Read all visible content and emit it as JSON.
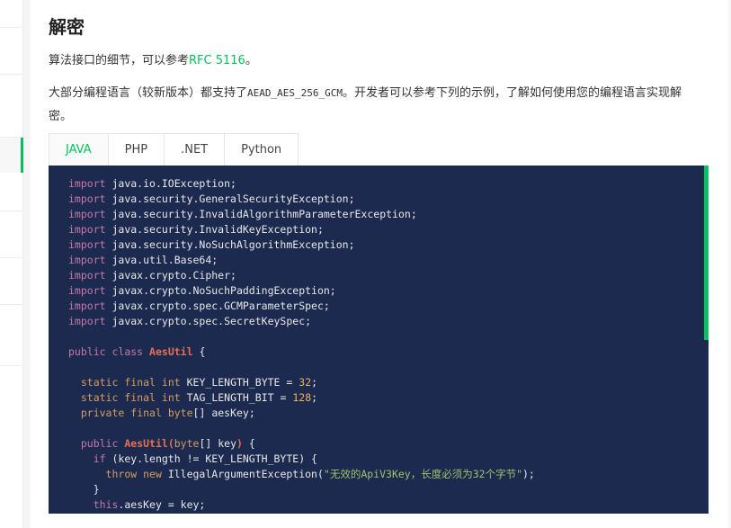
{
  "section": {
    "title": "解密",
    "para1_prefix": "算法接口的细节，可以参考",
    "para1_link": "RFC 5116",
    "para1_suffix": "。",
    "para2_prefix": "大部分编程语言（较新版本）都支持了",
    "para2_code": "AEAD_AES_256_GCM",
    "para2_suffix": "。开发者可以参考下列的示例，了解如何使用您的编程语言实现解密。"
  },
  "tabs": [
    {
      "label": "JAVA",
      "active": true
    },
    {
      "label": "PHP",
      "active": false
    },
    {
      "label": ".NET",
      "active": false
    },
    {
      "label": "Python",
      "active": false
    }
  ],
  "code": {
    "imports": [
      "java.io.IOException;",
      "java.security.GeneralSecurityException;",
      "java.security.InvalidAlgorithmParameterException;",
      "java.security.InvalidKeyException;",
      "java.security.NoSuchAlgorithmException;",
      "java.util.Base64;",
      "javax.crypto.Cipher;",
      "javax.crypto.NoSuchPaddingException;",
      "javax.crypto.spec.GCMParameterSpec;",
      "javax.crypto.spec.SecretKeySpec;"
    ],
    "class_name": "AesUtil",
    "key_length_name": "KEY_LENGTH_BYTE",
    "key_length_value": "32",
    "tag_length_name": "TAG_LENGTH_BIT",
    "tag_length_value": "128",
    "field_name": "aesKey",
    "exception_message": "\"无效的ApiV3Key，长度必须为32个字节\""
  },
  "colors": {
    "accent": "#07c160",
    "code_bg": "#1c2a4f"
  }
}
